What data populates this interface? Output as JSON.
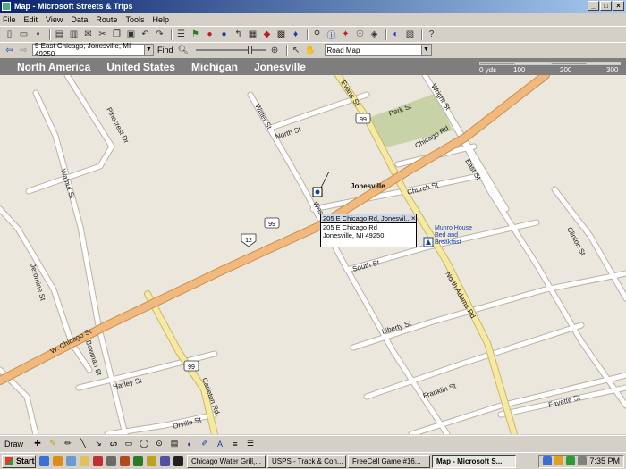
{
  "window": {
    "title": "Map - Microsoft Streets & Trips"
  },
  "menu": [
    "File",
    "Edit",
    "View",
    "Data",
    "Route",
    "Tools",
    "Help"
  ],
  "toolbar2": {
    "address_value": "5 East Chicago, Jonesville, MI 49250",
    "find_label": "Find",
    "map_style": "Road Map"
  },
  "breadcrumb": [
    "North America",
    "United States",
    "Michigan",
    "Jonesville"
  ],
  "scale_bar": {
    "labels": [
      "0 yds",
      "100",
      "200",
      "300"
    ]
  },
  "map": {
    "streets": [
      "Pinecrest Dr",
      "Walnut St",
      "Water St",
      "North St",
      "Evans St",
      "Wright St",
      "Park St",
      "Chicago Rd",
      "Church St",
      "East St",
      "West St",
      "South St",
      "North Adams Rd",
      "Liberty St",
      "Clinton St",
      "Jeromine St",
      "W. Chicago St",
      "Bowman St",
      "Harley St",
      "Carleton Rd",
      "Orville St",
      "Franklin St",
      "Fayette St"
    ],
    "route_shields": [
      "99",
      "99",
      "12",
      "99"
    ],
    "town_label": "Jonesville",
    "poi_label": [
      "Munro House",
      "Bed and",
      "Breakfast"
    ]
  },
  "popup": {
    "title": "205 E Chicago Rd, Jonesvil...",
    "line1": "205 E Chicago Rd",
    "line2": "Jonesville, MI 49250"
  },
  "drawbar": {
    "draw_label": "Draw"
  },
  "taskbar": {
    "start_label": "Start",
    "tasks": [
      "Chicago Water Grill,...",
      "USPS - Track & Con...",
      "FreeCell Game #16...",
      "Map - Microsoft S..."
    ],
    "clock": "7:35 PM"
  },
  "colors": {
    "map_bg": "#ece7dc",
    "highway": "#f2b97e",
    "state_road": "#f6e9a4",
    "street": "#ffffff",
    "park": "#c7d2a6",
    "breadcrumb_bar": "#7e7e7e"
  }
}
